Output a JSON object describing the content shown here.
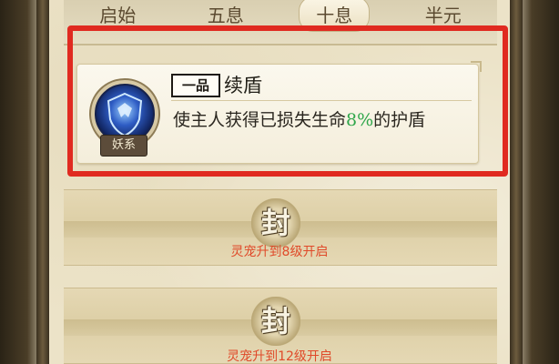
{
  "tabs": [
    {
      "label": "启始",
      "active": false
    },
    {
      "label": "五息",
      "active": false
    },
    {
      "label": "十息",
      "active": true
    },
    {
      "label": "半元",
      "active": false
    }
  ],
  "skill": {
    "rank": "一品",
    "name": "续盾",
    "school": "妖系",
    "icon": "shield-beast-icon",
    "desc_prefix": "使主人获得已损失生命",
    "desc_value": "8%",
    "desc_suffix": "的护盾"
  },
  "locked_slots": [
    {
      "seal": "封",
      "unlock_text": "灵宠升到8级开启"
    },
    {
      "seal": "封",
      "unlock_text": "灵宠升到12级开启"
    }
  ],
  "colors": {
    "highlight": "#e02a20",
    "percent_green": "#2ea64a",
    "unlock_red": "#e04a2a"
  }
}
